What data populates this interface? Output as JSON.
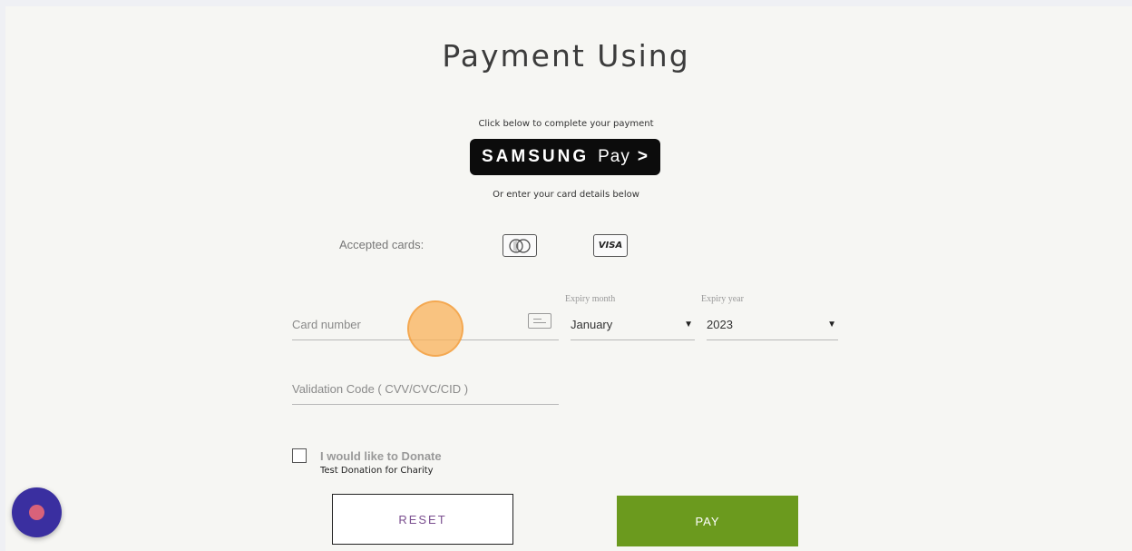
{
  "page": {
    "title": "Payment Using",
    "click_hint": "Click below to complete your payment",
    "or_hint": "Or enter your card details below"
  },
  "samsung_pay": {
    "brand": "SAMSUNG",
    "pay": "Pay",
    "chevron": ">"
  },
  "accepted_cards": {
    "label": "Accepted cards:",
    "visa": "VISA",
    "icons": [
      "mastercard-icon",
      "visa-icon"
    ]
  },
  "form": {
    "card_number_placeholder": "Card number",
    "card_number_value": "",
    "expiry_month_label": "Expiry month",
    "expiry_month_value": "January",
    "expiry_year_label": "Expiry year",
    "expiry_year_value": "2023",
    "cvv_placeholder": "Validation Code ( CVV/CVC/CID )",
    "cvv_value": ""
  },
  "donation": {
    "label": "I would like to Donate",
    "sub": "Test Donation for Charity",
    "checked": false
  },
  "buttons": {
    "reset": "RESET",
    "pay": "PAY"
  },
  "colors": {
    "pay_button": "#6b9a1e",
    "reset_text": "#7a4e8f",
    "fab": "#3a2fa0",
    "fab_dot": "#d8627a",
    "click_highlight": "#f9b25a"
  }
}
